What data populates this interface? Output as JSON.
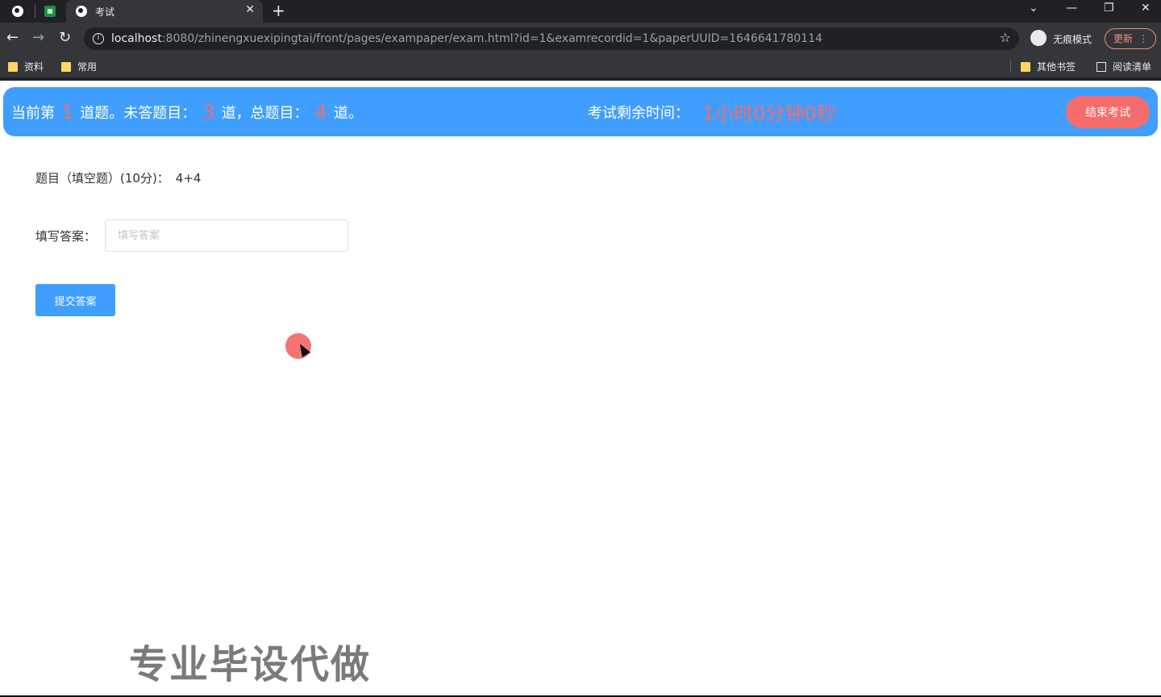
{
  "browser": {
    "tab_title": "考试",
    "url_host": "localhost",
    "url_rest": ":8080/zhinengxuexipingtai/front/pages/exampaper/exam.html?id=1&examrecordid=1&paperUUID=1646641780114",
    "incognito_label": "无痕模式",
    "update_label": "更新",
    "bookmarks": [
      "资料",
      "常用"
    ],
    "bookmarks_right": [
      "其他书签",
      "阅读清单"
    ]
  },
  "exam_header": {
    "current_prefix": "当前第",
    "current_num": "1",
    "current_suffix": "道题。未答题目：",
    "unanswered_num": "3",
    "unanswered_suffix": "道，总题目：",
    "total_num": "4",
    "total_suffix": "道。",
    "time_label": "考试剩余时间：",
    "time_value": "1小时0分钟0秒",
    "end_button": "结束考试"
  },
  "question": {
    "label": "题目（填空题）(10分)：",
    "content": "4+4"
  },
  "answer": {
    "label": "填写答案：",
    "placeholder": "填写答案",
    "value": ""
  },
  "submit_button": "提交答案",
  "watermark": "专业毕设代做",
  "colors": {
    "primary": "#409eff",
    "danger": "#f56c6c"
  }
}
